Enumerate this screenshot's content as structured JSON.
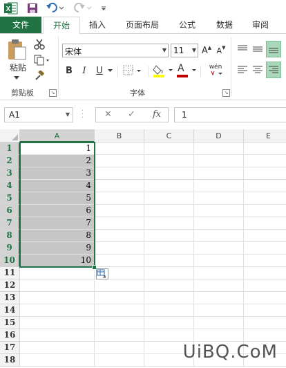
{
  "app": {
    "brand_color": "#217346",
    "logo_letter": "X"
  },
  "tabs": [
    {
      "label": "文件"
    },
    {
      "label": "开始"
    },
    {
      "label": "插入"
    },
    {
      "label": "页面布局"
    },
    {
      "label": "公式"
    },
    {
      "label": "数据"
    },
    {
      "label": "审阅"
    }
  ],
  "ribbon": {
    "paste_label": "粘贴",
    "clipboard_label": "剪贴板",
    "font_group_label": "字体",
    "font_name": "宋体",
    "font_size": "11",
    "bold": "B",
    "italic": "I",
    "underline": "U",
    "grow_font": "A",
    "shrink_font": "A",
    "font_color_letter": "A",
    "phonetic": "wén",
    "font_color": "#c00000",
    "highlight_color": "#ffff00"
  },
  "formula_bar": {
    "name_box": "A1",
    "fx": "fx",
    "value": "1"
  },
  "grid": {
    "columns": [
      "A",
      "B",
      "C",
      "D",
      "E"
    ],
    "rows": [
      "1",
      "2",
      "3",
      "4",
      "5",
      "6",
      "7",
      "8",
      "9",
      "10",
      "11",
      "12",
      "13",
      "14",
      "15",
      "16",
      "17",
      "18"
    ],
    "values": [
      "1",
      "2",
      "3",
      "4",
      "5",
      "6",
      "7",
      "8",
      "9",
      "10"
    ]
  },
  "watermark": "UiBQ.CoM"
}
